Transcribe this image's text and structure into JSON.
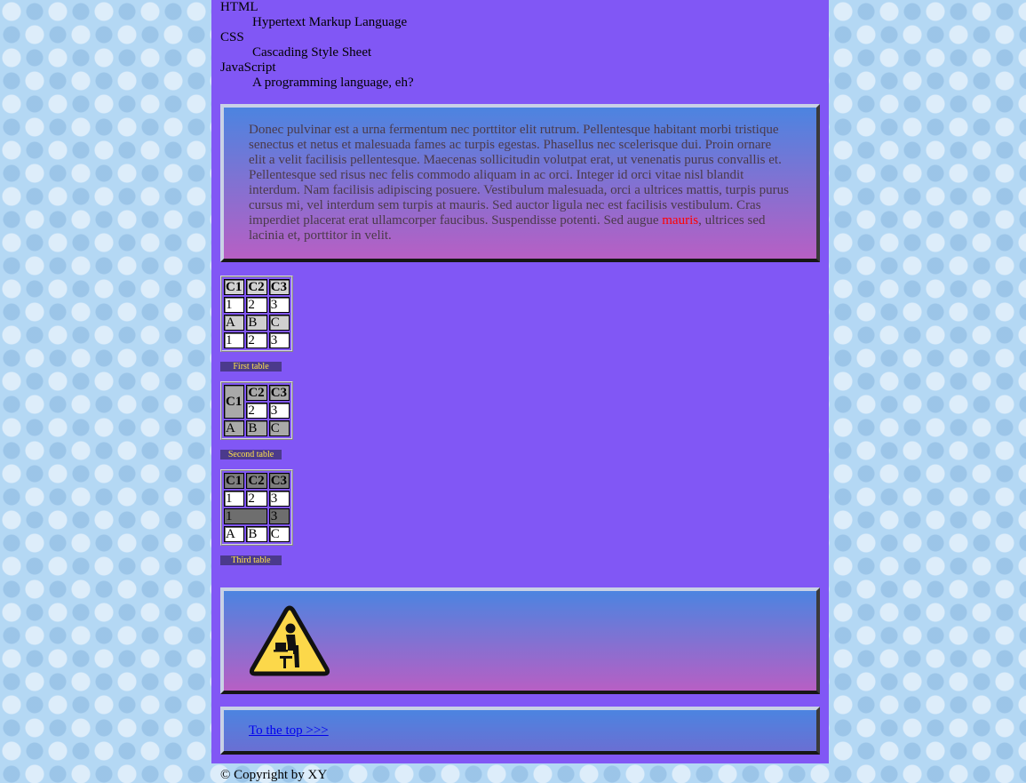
{
  "definitions": [
    {
      "term": "HTML",
      "desc": "Hypertext Markup Language"
    },
    {
      "term": "CSS",
      "desc": "Cascading Style Sheet"
    },
    {
      "term": "JavaScript",
      "desc": "A programming language, eh?"
    }
  ],
  "lorem": {
    "before": "Donec pulvinar est a urna fermentum nec porttitor elit rutrum. Pellentesque habitant morbi tristique senectus et netus et malesuada fames ac turpis egestas. Phasellus nec scelerisque dui. Proin ornare elit a velit facilisis pellentesque. Maecenas sollicitudin volutpat erat, ut venenatis purus convallis et. Pellentesque sed risus nec felis commodo aliquam in ac orci. Integer id orci vitae nisl blandit interdum. Nam facilisis adipiscing posuere. Vestibulum malesuada, orci a ultrices mattis, turpis purus cursus mi, vel interdum sem turpis at mauris. Sed auctor ligula nec est facilisis vestibulum. Cras imperdiet placerat erat ullamcorper faucibus. Suspendisse potenti. Sed augue ",
    "highlight": "mauris",
    "after": ", ultrices sed lacinia et, porttitor in velit.",
    "highlight_color": "#ff0000"
  },
  "table1": {
    "caption": "First table",
    "headers": [
      "C1",
      "C2",
      "C3"
    ],
    "rows": [
      [
        "1",
        "2",
        "3"
      ],
      [
        "A",
        "B",
        "C"
      ],
      [
        "1",
        "2",
        "3"
      ]
    ]
  },
  "table2": {
    "caption": "Second table",
    "headers": [
      "C1",
      "C2",
      "C3"
    ],
    "rows": [
      [
        "2",
        "3"
      ],
      [
        "A",
        "B",
        "C"
      ]
    ]
  },
  "table3": {
    "caption": "Third table",
    "headers": [
      "C1",
      "C2",
      "C3"
    ],
    "rows": [
      [
        "1",
        "2",
        "3"
      ],
      [
        "1",
        "3"
      ],
      [
        "A",
        "B",
        "C"
      ]
    ]
  },
  "banner_icon": "person-at-computer-warning-icon",
  "top_link": "To the top >>>",
  "footer": "© Copyright by XY",
  "colors": {
    "page_background": "#8157f5",
    "panel_gradient_top": "#4c84e0",
    "panel_gradient_bottom": "#b75fc4",
    "caption_background": "#4b3a8c",
    "caption_text": "#ffe24a",
    "warning_yellow": "#fcd84a"
  }
}
